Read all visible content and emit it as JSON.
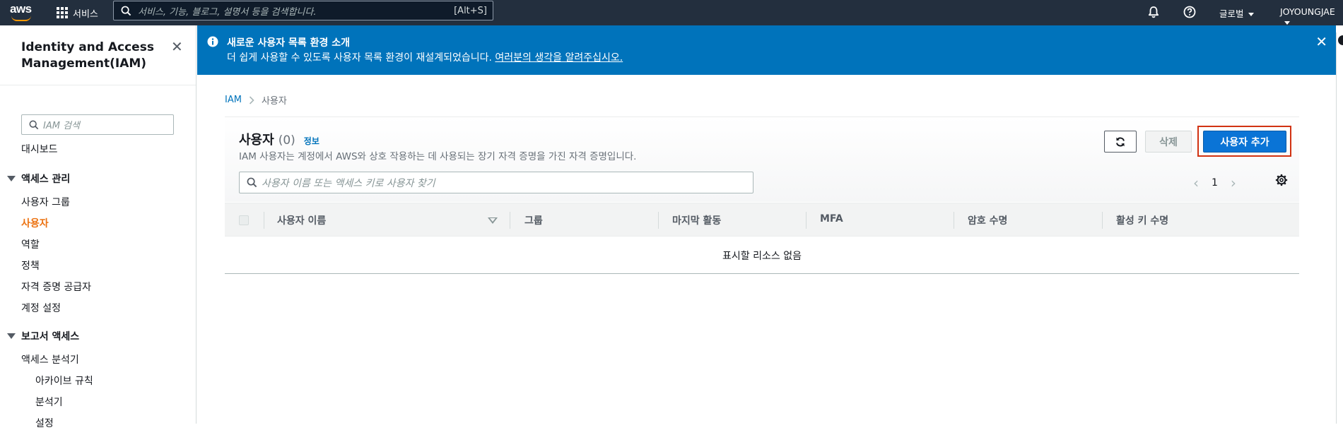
{
  "topnav": {
    "logo_text": "aws",
    "services_label": "서비스",
    "search_placeholder": "서비스, 기능, 블로그, 설명서 등을 검색합니다.",
    "search_shortcut": "[Alt+S]",
    "region_label": "글로벌",
    "account_label": "JOYOUNGJAE",
    "icons": [
      "grid-icon",
      "search-icon",
      "bell-icon",
      "help-icon"
    ]
  },
  "banner": {
    "title": "새로운 사용자 목록 환경 소개",
    "text": "더 쉽게 사용할 수 있도록 사용자 목록 환경이 재설계되었습니다.",
    "link": "여러분의 생각을 알려주십시오.",
    "color": "#0073bb"
  },
  "sidebar": {
    "title": "Identity and Access Management(IAM)",
    "search_placeholder": "IAM 검색",
    "dashboard": "대시보드",
    "section_access": "액세스 관리",
    "access_items": [
      "사용자 그룹",
      "사용자",
      "역할",
      "정책",
      "자격 증명 공급자",
      "계정 설정"
    ],
    "active_item": "사용자",
    "section_reports": "보고서 액세스",
    "report_items": [
      "액세스 분석기",
      "아카이브 규칙",
      "분석기",
      "설정"
    ]
  },
  "breadcrumb": {
    "root": "IAM",
    "current": "사용자"
  },
  "panel": {
    "title": "사용자",
    "count": "(0)",
    "info_link": "정보",
    "description": "IAM 사용자는 계정에서 AWS와 상호 작용하는 데 사용되는 장기 자격 증명을 가진 자격 증명입니다.",
    "delete_label": "삭제",
    "add_label": "사용자 추가",
    "search_placeholder": "사용자 이름 또는 액세스 키로 사용자 찾기",
    "page_number": "1",
    "columns": [
      "사용자 이름",
      "그룹",
      "마지막 활동",
      "MFA",
      "암호 수명",
      "활성 키 수명"
    ],
    "empty_text": "표시할 리소스 없음",
    "accent_color": "#0a74d6",
    "highlight_color": "#d13212"
  }
}
